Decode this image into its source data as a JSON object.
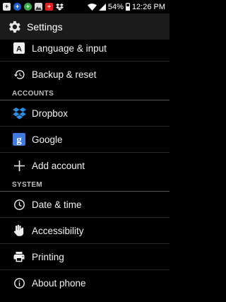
{
  "status_bar": {
    "battery": "54%",
    "time": "12:26 PM"
  },
  "action_bar": {
    "title": "Settings",
    "icon": "gear-icon"
  },
  "list": {
    "items_top": [
      {
        "label": "Language & input",
        "icon": "language-input-icon"
      },
      {
        "label": "Backup & reset",
        "icon": "backup-reset-icon"
      }
    ],
    "accounts_header": "ACCOUNTS",
    "accounts": [
      {
        "label": "Dropbox",
        "icon": "dropbox-icon",
        "color": "#2b8fe6"
      },
      {
        "label": "Google",
        "icon": "google-g-icon",
        "color": "#3f7be0"
      },
      {
        "label": "Add account",
        "icon": "plus-icon"
      }
    ],
    "system_header": "SYSTEM",
    "system": [
      {
        "label": "Date & time",
        "icon": "clock-icon"
      },
      {
        "label": "Accessibility",
        "icon": "hand-icon"
      },
      {
        "label": "Printing",
        "icon": "printer-icon"
      },
      {
        "label": "About phone",
        "icon": "info-icon"
      }
    ]
  }
}
